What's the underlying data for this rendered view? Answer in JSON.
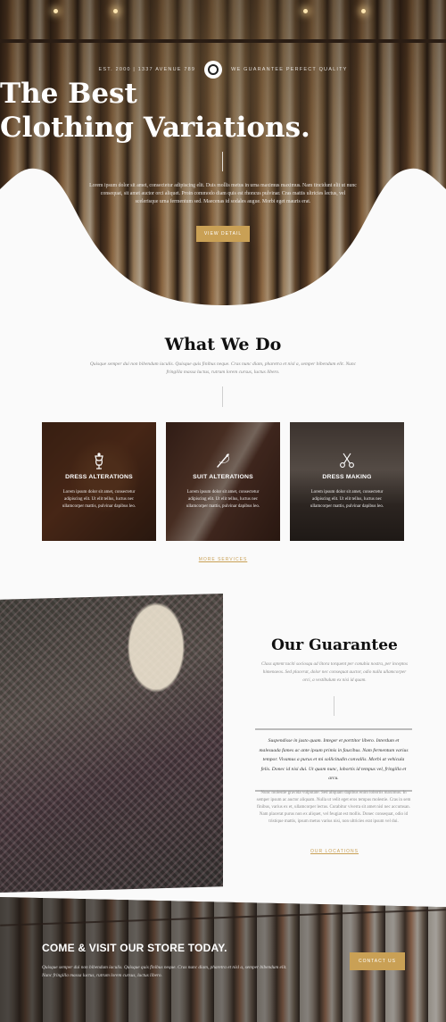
{
  "hero": {
    "meta_left": "EST. 2000 | 1337 AVENUE 789",
    "meta_right": "WE GUARANTEE PERFECT QUALITY",
    "title_line1": "The Best",
    "title_line2": "Clothing Variations.",
    "description": "Lorem ipsum dolor sit amet, consectetur adipiscing elit. Duis mollis metus in urna maximus maximus. Nam tincidunt elit ut nunc consequat, sit amet auctor orci aliquet. Proin commodo diam quis est rhoncus pulvinar. Cras mattis ultricies lectus, vel scelerisque urna fermentum sed. Maecenas id sodales augue. Morbi eget mauris erat.",
    "button": "VIEW DETAIL"
  },
  "what_we_do": {
    "title": "What We Do",
    "subtitle": "Quisque semper dui non bibendum iaculis. Quisque quis finibus neque. Cras nunc diam, pharetra et nisl a, semper bibendum elit. Nunc fringilla massa luctus, rutrum lorem cursus, luctus libero.",
    "services": [
      {
        "name": "DRESS ALTERATIONS",
        "icon": "mannequin-icon",
        "text": "Lorem ipsum dolor sit amet, consectetur adipiscing elit. Ut elit tellus, luctus nec ullamcorper mattis, pulvinar dapibus leo."
      },
      {
        "name": "SUIT ALTERATIONS",
        "icon": "needle-icon",
        "text": "Lorem ipsum dolor sit amet, consectetur adipiscing elit. Ut elit tellus, luctus nec ullamcorper mattis, pulvinar dapibus leo."
      },
      {
        "name": "DRESS MAKING",
        "icon": "scissors-icon",
        "text": "Lorem ipsum dolor sit amet, consectetur adipiscing elit. Ut elit tellus, luctus nec ullamcorper mattis, pulvinar dapibus leo."
      }
    ],
    "more_link": "MORE SERVICES"
  },
  "guarantee": {
    "title": "Our Guarantee",
    "subtitle": "Class aptent taciti sociosqu ad litora torquent per conubia nostra, per inceptos himenaeos. Sed placerat, dolor nec consequat auctor, odio nulla ullamcorper orci, a vestibulum ex nisi id quam.",
    "quote": "Suspendisse in justo quam. Integer et porttitor libero. Interdum et malesuada fames ac ante ipsum primis in faucibus. Nam fermentum varius tempor. Vivamus a purus et mi sollicitudin convallis. Morbi at vehicula felis. Donec id nisi dui. Ut quam nunc, lobortis id tempus vel, fringilla et arcu.",
    "text": "Nunc molestie gravida vulputate. Sed aliquam dapibus enim lobortis maximus. In semper ipsum ac auctor aliquam. Nulla ut velit eget eros tempus molestie. Cras in sem finibus, varius ex et, ullamcorper lectus. Curabitur viverra sit amet nisl nec accumsan. Nam placerat purus non ex aliquet, vel feugiat est mollis. Donec consequat, odio id tristique mattis, ipsum metus varius nisi, non ultricies erat ipsum vel dui.",
    "link": "OUR LOCATIONS"
  },
  "cta": {
    "title": "COME & VISIT OUR STORE TODAY.",
    "text": "Quisque semper dui non bibendum iaculis. Quisque quis finibus neque. Cras nunc diam, pharetra et nisl a, semper bibendum elit. Nunc fringilla massa luctus, rutrum lorem cursus, luctus libero.",
    "button": "CONTACT US"
  },
  "colors": {
    "accent": "#c9a055",
    "heading": "#111111",
    "background": "#fafafa"
  }
}
